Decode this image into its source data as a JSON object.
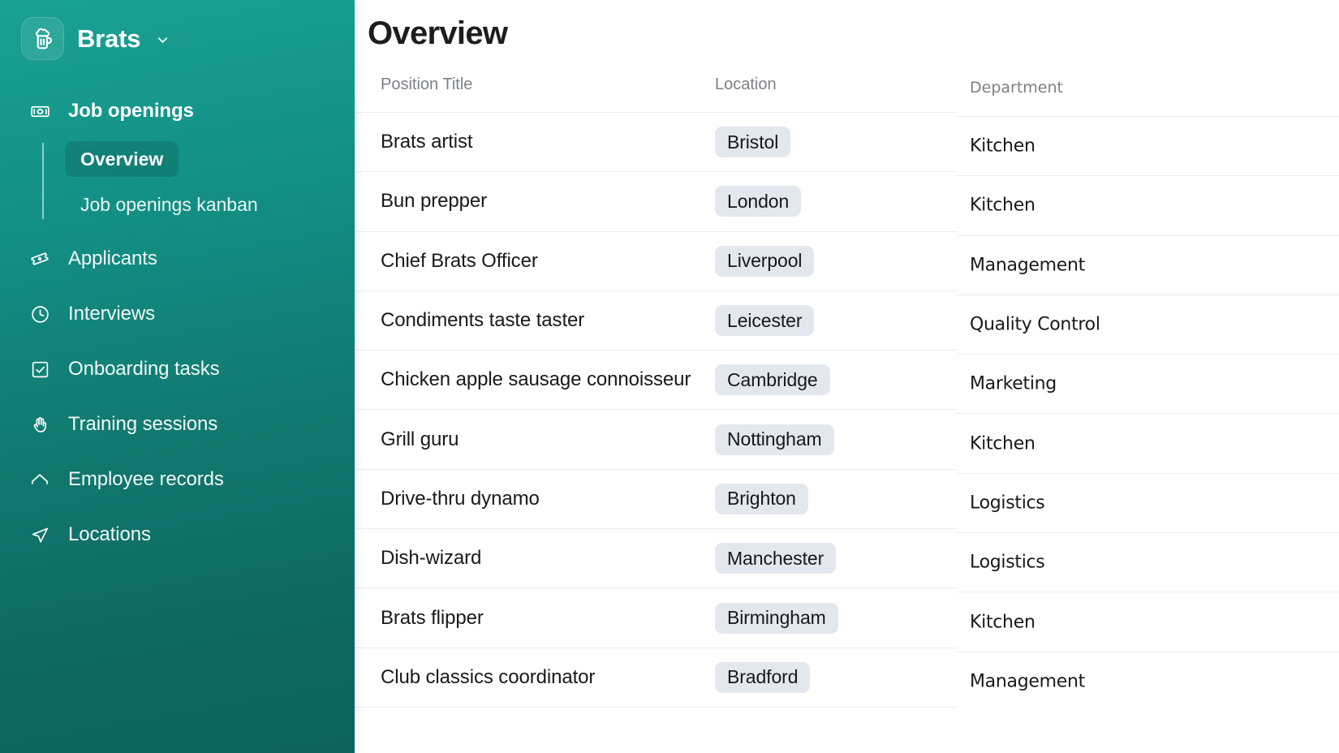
{
  "sidebar": {
    "brand": {
      "name": "Brats",
      "logo_icon": "beer-mug-icon",
      "caret_icon": "chevron-down-icon"
    },
    "primary": {
      "label": "Job openings",
      "icon": "banknote-icon"
    },
    "subitems": [
      {
        "label": "Overview",
        "active": true
      },
      {
        "label": "Job openings kanban",
        "active": false
      }
    ],
    "items": [
      {
        "label": "Applicants",
        "icon": "ticket-icon"
      },
      {
        "label": "Interviews",
        "icon": "clock-icon"
      },
      {
        "label": "Onboarding tasks",
        "icon": "checkbox-icon"
      },
      {
        "label": "Training sessions",
        "icon": "hand-icon"
      },
      {
        "label": "Employee records",
        "icon": "home-icon"
      },
      {
        "label": "Locations",
        "icon": "send-icon"
      }
    ]
  },
  "main": {
    "title": "Overview",
    "columns": {
      "position_title": "Position Title",
      "location": "Location",
      "department": "Department"
    },
    "rows": [
      {
        "position_title": "Brats artist",
        "location": "Bristol",
        "department": "Kitchen"
      },
      {
        "position_title": "Bun prepper",
        "location": "London",
        "department": "Kitchen"
      },
      {
        "position_title": "Chief Brats Officer",
        "location": "Liverpool",
        "department": "Management"
      },
      {
        "position_title": "Condiments taste taster",
        "location": "Leicester",
        "department": "Quality Control"
      },
      {
        "position_title": "Chicken apple sausage connoisseur",
        "location": "Cambridge",
        "department": "Marketing"
      },
      {
        "position_title": "Grill guru",
        "location": "Nottingham",
        "department": "Kitchen"
      },
      {
        "position_title": "Drive-thru dynamo",
        "location": "Brighton",
        "department": "Logistics"
      },
      {
        "position_title": "Dish-wizard",
        "location": "Manchester",
        "department": "Logistics"
      },
      {
        "position_title": "Brats flipper",
        "location": "Birmingham",
        "department": "Kitchen"
      },
      {
        "position_title": "Club classics coordinator",
        "location": "Bradford",
        "department": "Management"
      }
    ]
  },
  "colors": {
    "sidebar_top": "#19a193",
    "sidebar_bottom": "#0d625c",
    "badge_bg": "#e3e7ee",
    "text_primary": "#19191b",
    "text_muted": "#7c7f85",
    "row_divider": "#ededf0"
  }
}
